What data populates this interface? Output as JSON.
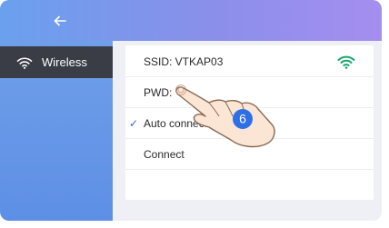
{
  "sidebar": {
    "items": [
      {
        "label": "Wireless",
        "icon": "wifi-icon"
      }
    ]
  },
  "header": {
    "back_icon": "back-arrow-icon"
  },
  "wifi": {
    "ssid_label": "SSID: VTKAP03",
    "pwd_label": "PWD:",
    "auto_connect_label": "Auto connect",
    "auto_connect_checked": true,
    "connect_label": "Connect",
    "signal_icon": "wifi-signal-icon"
  },
  "annotation": {
    "step_number": "6",
    "pointer_icon": "hand-pointer-icon"
  },
  "colors": {
    "topbar_start": "#6aa0ee",
    "topbar_end": "#a58ef0",
    "sidebar": "#5d8fe6",
    "sidebar_selected": "#3a3d46",
    "signal": "#16a86c",
    "checkmark": "#2f66e6",
    "step_badge": "#2f6fe6"
  }
}
